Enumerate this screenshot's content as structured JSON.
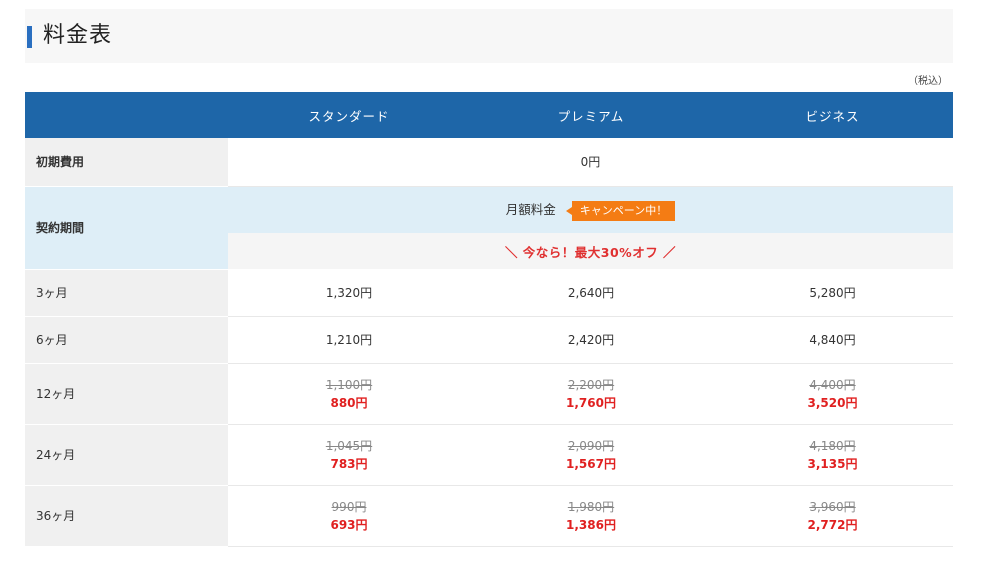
{
  "section": {
    "title": "料金表",
    "tax_note": "（税込）"
  },
  "colors": {
    "accent": "#2a6fc0",
    "header_bg": "#1e66a8",
    "campaign": "#f47c14",
    "discount_red": "#e03030",
    "light_blue": "#deeef7"
  },
  "table": {
    "columns": [
      "",
      "スタンダード",
      "プレミアム",
      "ビジネス"
    ],
    "initial_fee": {
      "label": "初期費用",
      "value": "0円"
    },
    "contract_period_label": "契約期間",
    "monthly_fee_label": "月額料金",
    "campaign_badge": "キャンペーン中！",
    "discount_banner": "＼ 今なら！最大30%オフ ／",
    "rows": [
      {
        "label": "3ヶ月",
        "prices": [
          {
            "current": "1,320円"
          },
          {
            "current": "2,640円"
          },
          {
            "current": "5,280円"
          }
        ]
      },
      {
        "label": "6ヶ月",
        "prices": [
          {
            "current": "1,210円"
          },
          {
            "current": "2,420円"
          },
          {
            "current": "4,840円"
          }
        ]
      },
      {
        "label": "12ヶ月",
        "prices": [
          {
            "old": "1,100円",
            "current": "880円"
          },
          {
            "old": "2,200円",
            "current": "1,760円"
          },
          {
            "old": "4,400円",
            "current": "3,520円"
          }
        ]
      },
      {
        "label": "24ヶ月",
        "prices": [
          {
            "old": "1,045円",
            "current": "783円"
          },
          {
            "old": "2,090円",
            "current": "1,567円"
          },
          {
            "old": "4,180円",
            "current": "3,135円"
          }
        ]
      },
      {
        "label": "36ヶ月",
        "prices": [
          {
            "old": "990円",
            "current": "693円"
          },
          {
            "old": "1,980円",
            "current": "1,386円"
          },
          {
            "old": "3,960円",
            "current": "2,772円"
          }
        ]
      }
    ]
  }
}
